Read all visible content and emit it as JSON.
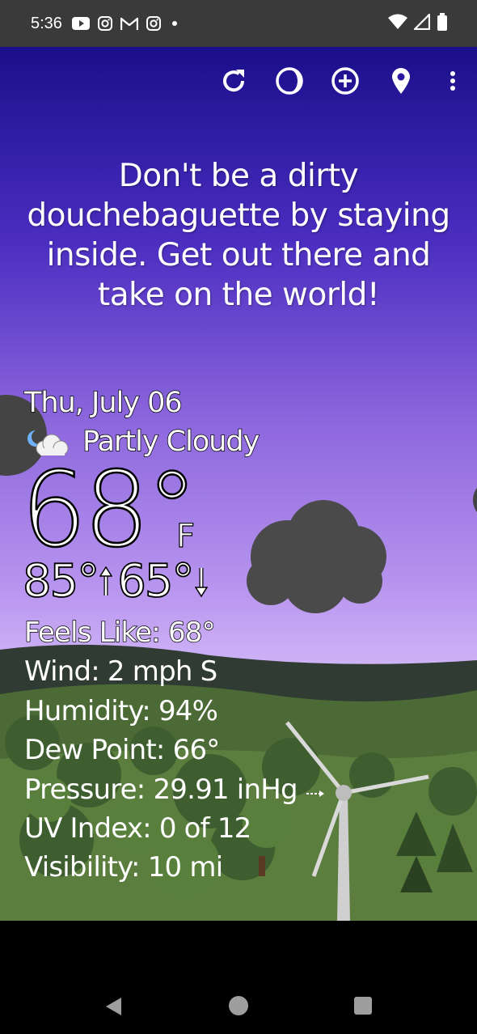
{
  "status_bar": {
    "time": "5:36",
    "notification_icons": [
      "youtube-icon",
      "instagram-icon",
      "gmail-icon",
      "instagram-icon",
      "dot-icon"
    ],
    "system_icons": [
      "wifi-icon",
      "cell-signal-icon",
      "battery-icon"
    ]
  },
  "toolbar": {
    "icons": [
      "refresh-icon",
      "moon-phase-icon",
      "add-icon",
      "location-icon",
      "more-vert-icon"
    ]
  },
  "quote": "Don't be a dirty douchebaguette by staying inside. Get out there and take on the world!",
  "weather": {
    "date": "Thu, July 06",
    "condition": "Partly Cloudy",
    "condition_icon": "partly-cloudy-night-icon",
    "temperature": "68°",
    "unit": "F",
    "high": "85°",
    "low": "65°",
    "details": [
      {
        "label": "Feels Like:",
        "value": "68°"
      },
      {
        "label": "Wind:",
        "value": "2 mph S"
      },
      {
        "label": "Humidity:",
        "value": "94%"
      },
      {
        "label": "Dew Point:",
        "value": "66°"
      },
      {
        "label": "Pressure:",
        "value": "29.91 inHg"
      },
      {
        "label": "UV Index:",
        "value": "0 of 12"
      },
      {
        "label": "Visibility:",
        "value": "10 mi"
      }
    ],
    "pressure_trend_icon": "steady-arrow-icon"
  },
  "colors": {
    "sky_top": "#1a0f8a",
    "sky_bottom": "#e7d6fb",
    "hill": "#3b5a2a",
    "status_bar": "#3a3a3a"
  },
  "nav_bar": {
    "buttons": [
      "back-icon",
      "home-icon",
      "recents-icon"
    ]
  }
}
